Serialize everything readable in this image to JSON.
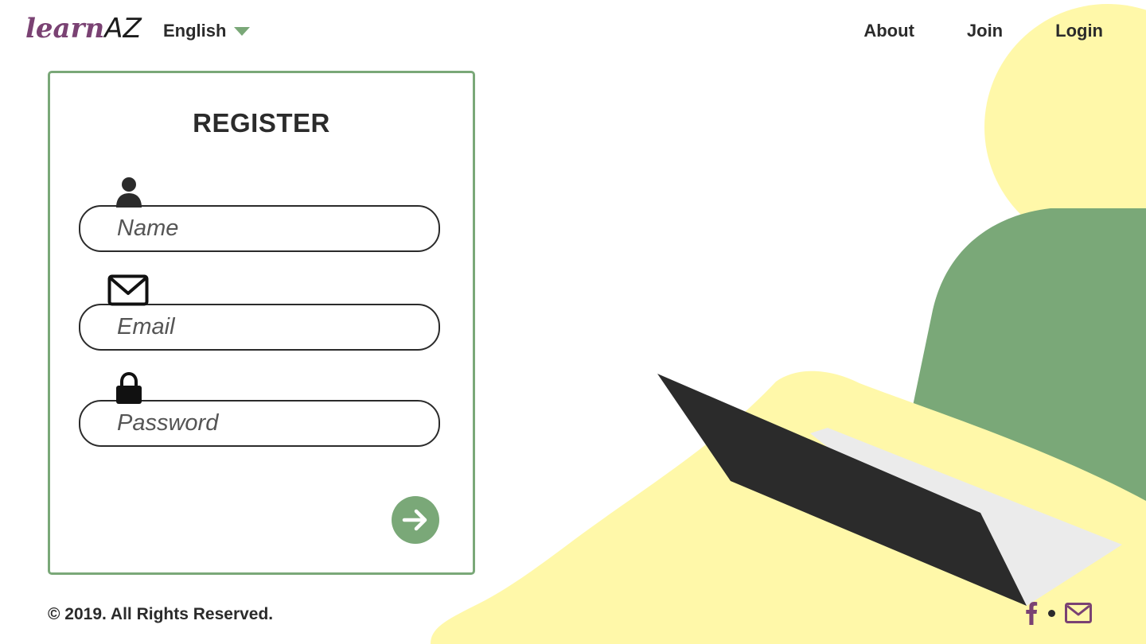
{
  "header": {
    "logo": {
      "part1": "learn",
      "part2": "AZ"
    },
    "language": {
      "selected": "English",
      "icon": "caret-down-icon"
    },
    "nav": [
      {
        "label": "About"
      },
      {
        "label": "Join"
      },
      {
        "label": "Login"
      }
    ]
  },
  "register": {
    "title": "REGISTER",
    "fields": {
      "name": {
        "placeholder": "Name",
        "value": "",
        "icon": "user-icon"
      },
      "email": {
        "placeholder": "Email",
        "value": "",
        "icon": "envelope-icon"
      },
      "password": {
        "placeholder": "Password",
        "value": "",
        "icon": "lock-icon"
      }
    },
    "submit_icon": "arrow-right-icon"
  },
  "footer": {
    "copyright": "© 2019. All Rights Reserved.",
    "social": [
      "facebook-icon",
      "envelope-icon"
    ]
  },
  "colors": {
    "accent_green": "#7aa878",
    "brand_purple": "#7a4273",
    "illustration_yellow": "#fff8a9",
    "dark": "#2b2b2b"
  }
}
